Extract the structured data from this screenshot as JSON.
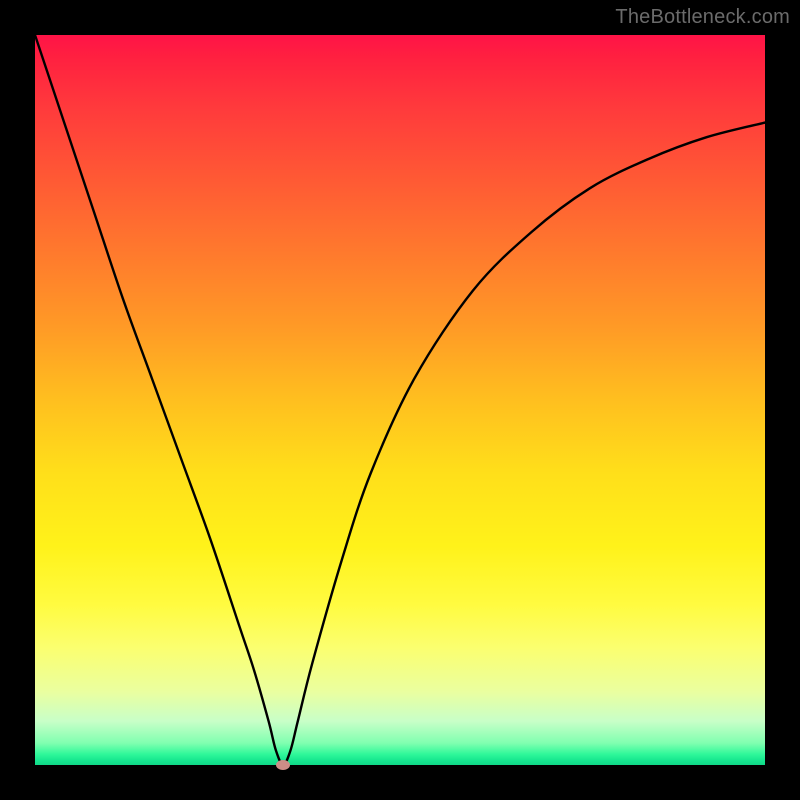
{
  "watermark": "TheBottleneck.com",
  "chart_data": {
    "type": "line",
    "title": "",
    "xlabel": "",
    "ylabel": "",
    "xlim": [
      0,
      100
    ],
    "ylim": [
      0,
      100
    ],
    "background_gradient": {
      "top": "#ff1347",
      "bottom": "#10d888",
      "meaning": "value heatmap (red high, green low)"
    },
    "series": [
      {
        "name": "bottleneck-curve",
        "x": [
          0,
          4,
          8,
          12,
          16,
          20,
          24,
          28,
          30,
          32,
          33,
          34,
          35,
          36,
          38,
          42,
          46,
          52,
          60,
          68,
          76,
          84,
          92,
          100
        ],
        "values": [
          100,
          88,
          76,
          64,
          53,
          42,
          31,
          19,
          13,
          6,
          2,
          0,
          2,
          6,
          14,
          28,
          40,
          53,
          65,
          73,
          79,
          83,
          86,
          88
        ]
      }
    ],
    "marker": {
      "x": 34,
      "y": 0,
      "color": "#cd8d87"
    }
  }
}
